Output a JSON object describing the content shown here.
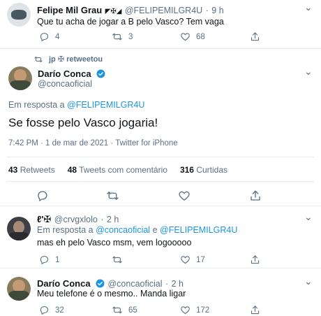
{
  "tweet1": {
    "name": "Felipe Mil Grau",
    "name_suffix": "◤✠◢",
    "handle": "@FELIPEMILGR4U",
    "time": "9 h",
    "text": "Que tu acha de jogar a B pelo Vasco? Tem vaga",
    "replies": "4",
    "retweets": "3",
    "likes": "68"
  },
  "retweet_line": {
    "label": "jp ✠ retweetou"
  },
  "main_tweet": {
    "name": "Darío Conca",
    "handle": "@concaoficial",
    "reply_prefix": "Em resposta a",
    "reply_to": "@FELIPEMILGR4U",
    "text": "Se fosse pelo Vasco jogaria!",
    "timestamp": "7:42 PM · 1 de mar de 2021 · Twitter for iPhone"
  },
  "stats": {
    "retweets_count": "43",
    "retweets_label": "Retweets",
    "quotes_count": "48",
    "quotes_label": "Tweets com comentário",
    "likes_count": "316",
    "likes_label": "Curtidas"
  },
  "reply1": {
    "name": "ℓ'✠",
    "handle": "@crvgxlolo",
    "time": "2 h",
    "reply_prefix": "Em resposta a",
    "reply_to_1": "@concaoficial",
    "reply_and": "e",
    "reply_to_2": "@FELIPEMILGR4U",
    "text": "mas eh pelo Vasco msm, vem logooooo",
    "replies": "1",
    "retweets": "",
    "likes": "17"
  },
  "reply2": {
    "name": "Darío Conca",
    "handle": "@concaoficial",
    "time": "2 h",
    "text": "Meu telefone é o mesmo.. Manda ligar",
    "replies": "32",
    "retweets": "65",
    "likes": "172"
  },
  "colors": {
    "accent": "#1b95e0",
    "muted": "#5b7083",
    "border": "#e6ecf0"
  }
}
